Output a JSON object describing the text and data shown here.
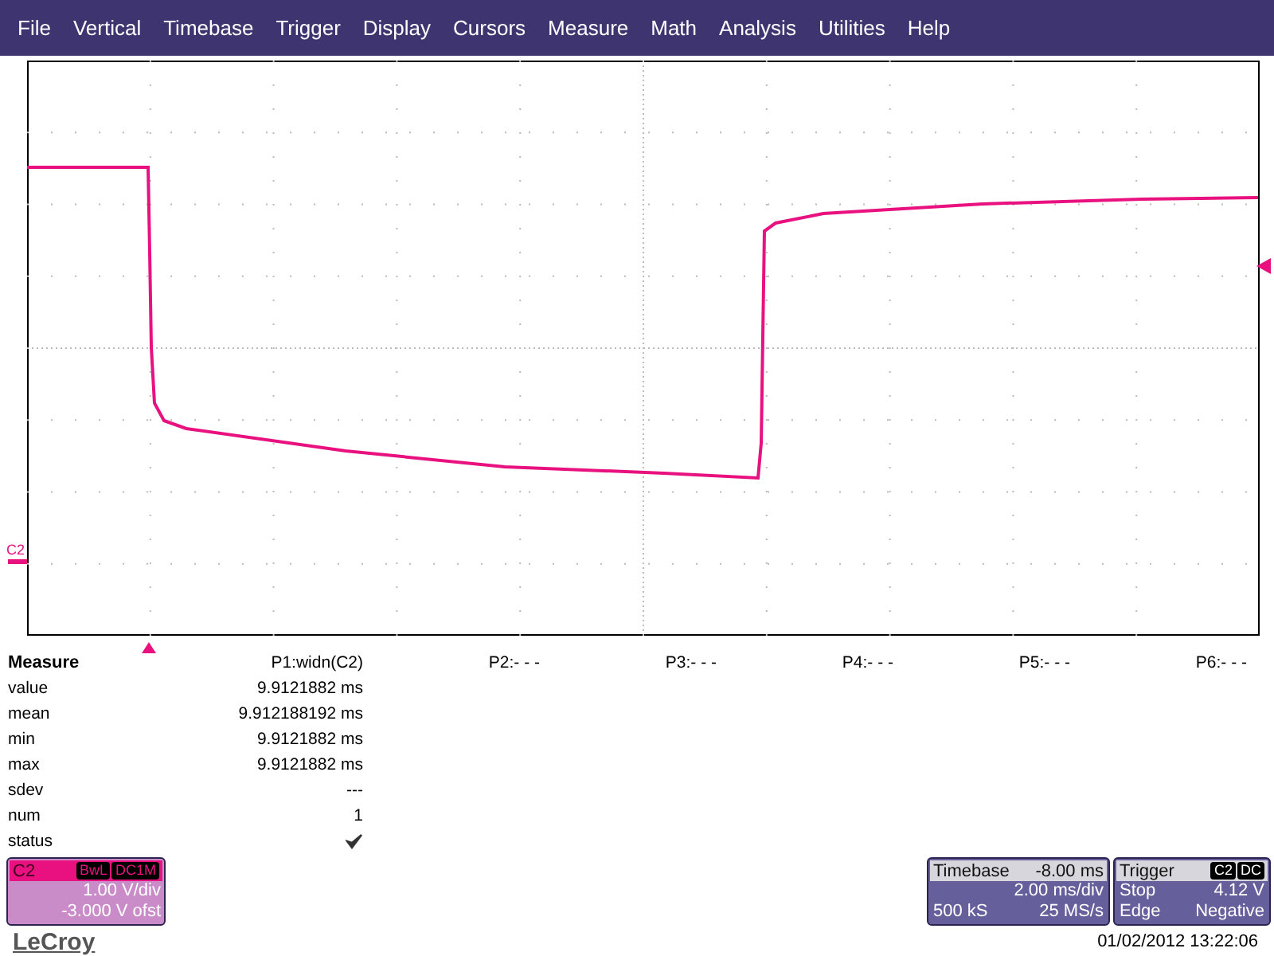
{
  "menu": [
    "File",
    "Vertical",
    "Timebase",
    "Trigger",
    "Display",
    "Cursors",
    "Measure",
    "Math",
    "Analysis",
    "Utilities",
    "Help"
  ],
  "display": {
    "channel_marker": "C2"
  },
  "measure": {
    "title": "Measure",
    "headers": [
      "P1:widn(C2)",
      "P2:- - -",
      "P3:- - -",
      "P4:- - -",
      "P5:- - -",
      "P6:- - -"
    ],
    "rows": [
      {
        "kind": "text",
        "label": "value",
        "cells": [
          "9.9121882 ms"
        ]
      },
      {
        "kind": "text",
        "label": "mean",
        "cells": [
          "9.912188192 ms"
        ]
      },
      {
        "kind": "text",
        "label": "min",
        "cells": [
          "9.9121882 ms"
        ]
      },
      {
        "kind": "text",
        "label": "max",
        "cells": [
          "9.9121882 ms"
        ]
      },
      {
        "kind": "text",
        "label": "sdev",
        "cells": [
          "---"
        ]
      },
      {
        "kind": "text",
        "label": "num",
        "cells": [
          "1"
        ]
      },
      {
        "kind": "check",
        "label": "status",
        "cells": []
      }
    ]
  },
  "channel": {
    "name": "C2",
    "tags": [
      "BwL",
      "DC1M"
    ],
    "scale": "1.00 V/div",
    "offset": "-3.000 V ofst"
  },
  "timebase": {
    "title": "Timebase",
    "delay": "-8.00 ms",
    "scale": "2.00 ms/div",
    "samples": "500 kS",
    "rate": "25 MS/s"
  },
  "trigger": {
    "title": "Trigger",
    "tags": [
      "C2",
      "DC"
    ],
    "mode": "Stop",
    "level": "4.12 V",
    "type": "Edge",
    "slope": "Negative"
  },
  "brand": "LeCroy",
  "timestamp": "01/02/2012 13:22:06"
}
